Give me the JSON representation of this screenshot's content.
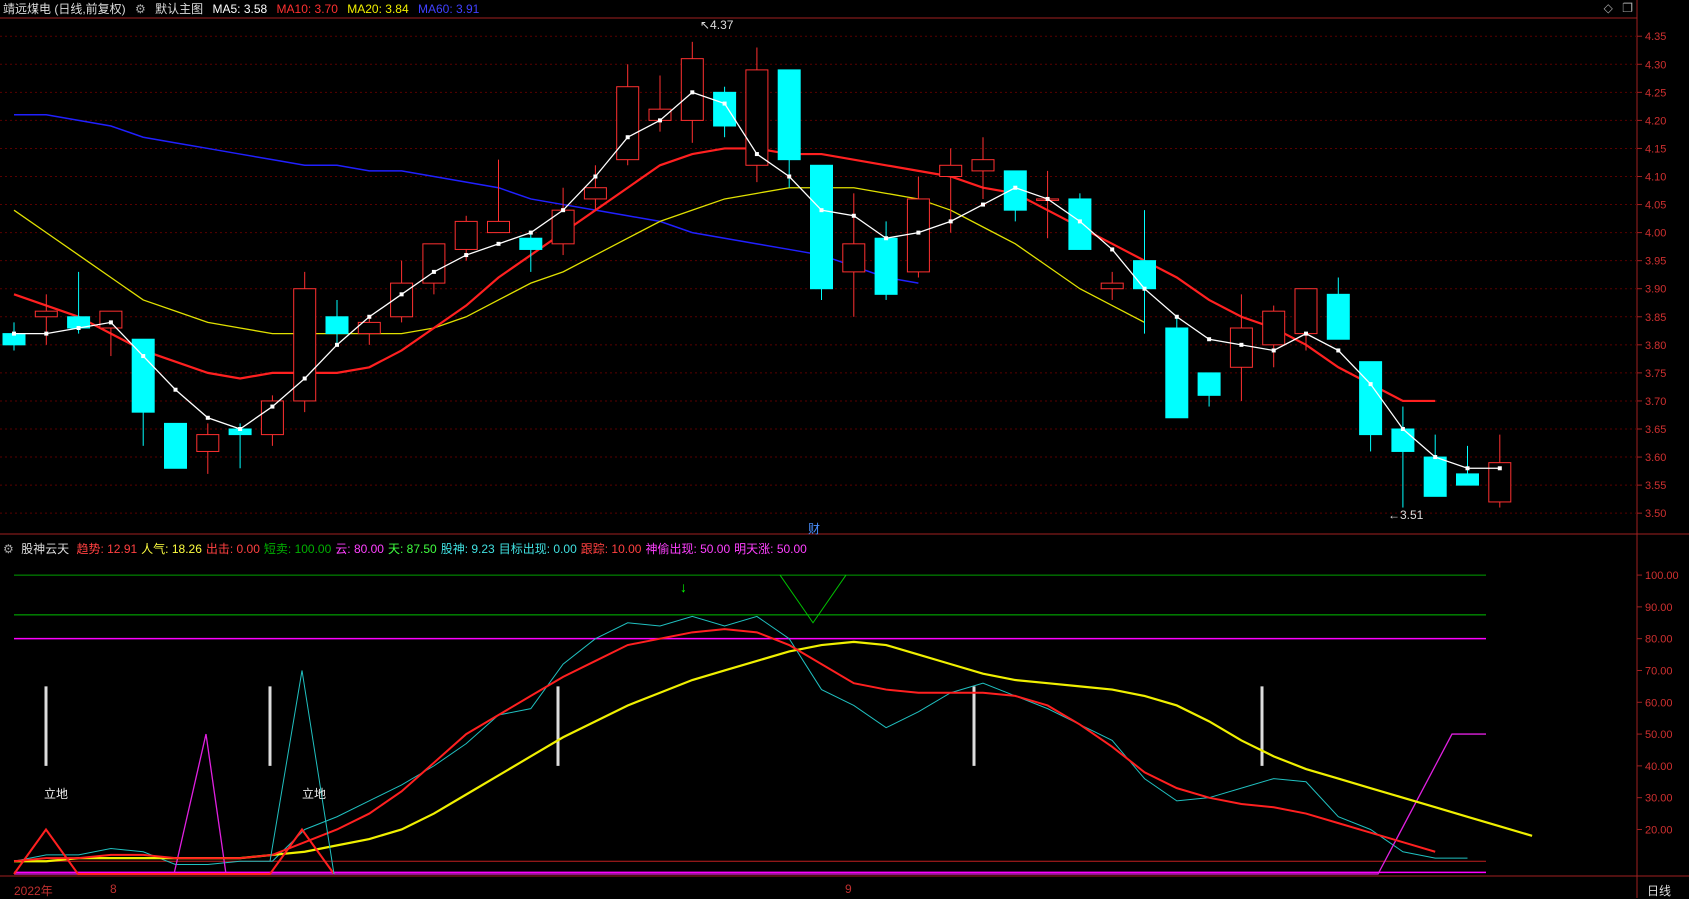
{
  "header": {
    "stock": "靖远煤电 (日线,前复权)",
    "main": "默认主图",
    "ma5_label": "MA5: 3.58",
    "ma10_label": "MA10: 3.70",
    "ma20_label": "MA20: 3.84",
    "ma60_label": "MA60: 3.91"
  },
  "indicator_header": {
    "name": "股神云天",
    "items": [
      {
        "text": "趋势: 12.91",
        "color": "#ff4040"
      },
      {
        "text": "人气: 18.26",
        "color": "#ffff40"
      },
      {
        "text": "出击: 0.00",
        "color": "#ff4040"
      },
      {
        "text": "短卖: 100.00",
        "color": "#00b000"
      },
      {
        "text": "云: 80.00",
        "color": "#ff40ff"
      },
      {
        "text": "天: 87.50",
        "color": "#40ff40"
      },
      {
        "text": "股神: 9.23",
        "color": "#40e0e0"
      },
      {
        "text": "目标出现: 0.00",
        "color": "#40e0e0"
      },
      {
        "text": "跟踪: 10.00",
        "color": "#ff4040"
      },
      {
        "text": "神偷出现: 50.00",
        "color": "#ff40ff"
      },
      {
        "text": "明天涨: 50.00",
        "color": "#ff40ff"
      }
    ]
  },
  "dates": {
    "year": "2022年",
    "m8": "8",
    "m9": "9"
  },
  "period": "日线",
  "cai": "财",
  "colors": {
    "up": "#ff3030",
    "down": "#00ffff",
    "ma5": "#ffffff",
    "ma10": "#ff2020",
    "ma20": "#e0e000",
    "ma60": "#2020ff"
  },
  "chart_data": [
    {
      "type": "candlestick",
      "ylim": [
        3.47,
        4.37
      ],
      "y_ticks": [
        3.5,
        3.55,
        3.6,
        3.65,
        3.7,
        3.75,
        3.8,
        3.85,
        3.9,
        3.95,
        4.0,
        4.05,
        4.1,
        4.15,
        4.2,
        4.25,
        4.3,
        4.35
      ],
      "candles": [
        [
          3.82,
          3.84,
          3.79,
          3.8
        ],
        [
          3.85,
          3.89,
          3.8,
          3.86
        ],
        [
          3.85,
          3.93,
          3.82,
          3.83
        ],
        [
          3.83,
          3.86,
          3.78,
          3.86
        ],
        [
          3.81,
          3.81,
          3.62,
          3.68
        ],
        [
          3.66,
          3.66,
          3.6,
          3.58
        ],
        [
          3.61,
          3.66,
          3.57,
          3.64
        ],
        [
          3.65,
          3.66,
          3.58,
          3.64
        ],
        [
          3.64,
          3.71,
          3.62,
          3.7
        ],
        [
          3.7,
          3.93,
          3.68,
          3.9
        ],
        [
          3.85,
          3.88,
          3.8,
          3.82
        ],
        [
          3.82,
          3.85,
          3.8,
          3.84
        ],
        [
          3.85,
          3.95,
          3.84,
          3.91
        ],
        [
          3.91,
          3.98,
          3.89,
          3.98
        ],
        [
          3.97,
          4.03,
          3.95,
          4.02
        ],
        [
          4.0,
          4.13,
          4.0,
          4.02
        ],
        [
          3.99,
          4.0,
          3.93,
          3.97
        ],
        [
          3.98,
          4.08,
          3.96,
          4.04
        ],
        [
          4.06,
          4.12,
          4.04,
          4.08
        ],
        [
          4.13,
          4.3,
          4.12,
          4.26
        ],
        [
          4.2,
          4.28,
          4.18,
          4.22
        ],
        [
          4.2,
          4.34,
          4.16,
          4.31
        ],
        [
          4.25,
          4.26,
          4.17,
          4.19
        ],
        [
          4.12,
          4.33,
          4.09,
          4.29
        ],
        [
          4.29,
          4.29,
          4.08,
          4.13
        ],
        [
          4.12,
          4.12,
          3.88,
          3.9
        ],
        [
          3.93,
          4.07,
          3.85,
          3.98
        ],
        [
          3.99,
          4.02,
          3.88,
          3.89
        ],
        [
          3.93,
          4.1,
          3.92,
          4.06
        ],
        [
          4.1,
          4.15,
          4.0,
          4.12
        ],
        [
          4.11,
          4.17,
          4.06,
          4.13
        ],
        [
          4.11,
          4.11,
          4.02,
          4.04
        ],
        [
          4.06,
          4.11,
          3.99,
          4.06
        ],
        [
          4.06,
          4.07,
          3.97,
          3.97
        ],
        [
          3.9,
          3.93,
          3.88,
          3.91
        ],
        [
          3.95,
          4.04,
          3.82,
          3.9
        ],
        [
          3.83,
          3.85,
          3.67,
          3.67
        ],
        [
          3.75,
          3.75,
          3.69,
          3.71
        ],
        [
          3.76,
          3.89,
          3.7,
          3.83
        ],
        [
          3.8,
          3.87,
          3.76,
          3.86
        ],
        [
          3.82,
          3.9,
          3.79,
          3.9
        ],
        [
          3.89,
          3.92,
          3.82,
          3.81
        ],
        [
          3.77,
          3.77,
          3.61,
          3.64
        ],
        [
          3.65,
          3.69,
          3.51,
          3.61
        ],
        [
          3.6,
          3.64,
          3.53,
          3.53
        ],
        [
          3.57,
          3.62,
          3.55,
          3.55
        ],
        [
          3.52,
          3.64,
          3.51,
          3.59
        ]
      ],
      "ma5": [
        3.82,
        3.82,
        3.83,
        3.84,
        3.78,
        3.72,
        3.67,
        3.65,
        3.69,
        3.74,
        3.8,
        3.85,
        3.89,
        3.93,
        3.96,
        3.98,
        4.0,
        4.04,
        4.1,
        4.17,
        4.2,
        4.25,
        4.23,
        4.14,
        4.1,
        4.04,
        4.03,
        3.99,
        4.0,
        4.02,
        4.05,
        4.08,
        4.06,
        4.02,
        3.97,
        3.9,
        3.85,
        3.81,
        3.8,
        3.79,
        3.82,
        3.79,
        3.73,
        3.65,
        3.6,
        3.58,
        3.58
      ],
      "ma10": [
        3.89,
        3.87,
        3.85,
        3.82,
        3.79,
        3.77,
        3.75,
        3.74,
        3.75,
        3.75,
        3.75,
        3.76,
        3.79,
        3.83,
        3.87,
        3.92,
        3.96,
        4.0,
        4.04,
        4.08,
        4.12,
        4.14,
        4.15,
        4.15,
        4.14,
        4.14,
        4.13,
        4.12,
        4.11,
        4.1,
        4.08,
        4.07,
        4.04,
        4.01,
        3.98,
        3.95,
        3.92,
        3.88,
        3.85,
        3.83,
        3.8,
        3.76,
        3.73,
        3.7,
        3.7
      ],
      "ma20": [
        4.04,
        4.0,
        3.96,
        3.92,
        3.88,
        3.86,
        3.84,
        3.83,
        3.82,
        3.82,
        3.82,
        3.82,
        3.82,
        3.83,
        3.85,
        3.88,
        3.91,
        3.93,
        3.96,
        3.99,
        4.02,
        4.04,
        4.06,
        4.07,
        4.08,
        4.08,
        4.08,
        4.07,
        4.06,
        4.04,
        4.01,
        3.98,
        3.94,
        3.9,
        3.87,
        3.84
      ],
      "ma60": [
        4.21,
        4.21,
        4.2,
        4.19,
        4.17,
        4.16,
        4.15,
        4.14,
        4.13,
        4.12,
        4.12,
        4.11,
        4.11,
        4.1,
        4.09,
        4.08,
        4.06,
        4.05,
        4.04,
        4.03,
        4.02,
        4.0,
        3.99,
        3.98,
        3.97,
        3.96,
        3.94,
        3.92,
        3.91
      ],
      "annotations": {
        "high": "4.37",
        "low": "3.51"
      }
    },
    {
      "type": "line",
      "name": "股神云天",
      "ylim": [
        6,
        106
      ],
      "y_ticks": [
        20,
        30,
        40,
        50,
        60,
        70,
        80,
        90,
        100
      ],
      "series": [
        {
          "key": "qushi",
          "values": [
            10,
            11,
            11,
            12,
            12,
            11,
            11,
            11,
            12,
            16,
            20,
            25,
            32,
            41,
            50,
            56,
            62,
            68,
            73,
            78,
            80,
            82,
            83,
            82,
            78,
            72,
            66,
            64,
            63,
            63,
            63,
            62,
            59,
            53,
            46,
            38,
            33,
            30,
            28,
            27,
            25,
            22,
            19,
            16,
            13
          ]
        },
        {
          "key": "renqi",
          "values": [
            10,
            10,
            11,
            11,
            11,
            11,
            11,
            11,
            12,
            13,
            15,
            17,
            20,
            25,
            31,
            37,
            43,
            49,
            54,
            59,
            63,
            67,
            70,
            73,
            76,
            78,
            79,
            78,
            75,
            72,
            69,
            67,
            66,
            65,
            64,
            62,
            59,
            54,
            48,
            43,
            39,
            36,
            33,
            30,
            27,
            24,
            21,
            18
          ]
        },
        {
          "key": "cyan",
          "values": [
            10,
            12,
            12,
            14,
            13,
            9,
            9,
            10,
            10,
            20,
            24,
            29,
            34,
            40,
            47,
            56,
            58,
            72,
            80,
            85,
            84,
            87,
            84,
            87,
            80,
            64,
            59,
            52,
            57,
            63,
            66,
            62,
            58,
            53,
            48,
            36,
            29,
            30,
            33,
            36,
            35,
            24,
            20,
            13,
            11,
            11
          ]
        },
        {
          "key": "magenta",
          "values": [
            6,
            6,
            6,
            6,
            6,
            6,
            50,
            6,
            6,
            6,
            6,
            6,
            6,
            6,
            6,
            6,
            6,
            6,
            6,
            6,
            6,
            6,
            6,
            6,
            6,
            6,
            6,
            6,
            6,
            6,
            6,
            6,
            6,
            6,
            6,
            6,
            6,
            6,
            6,
            6,
            6,
            6,
            6,
            6,
            50,
            50
          ]
        },
        {
          "key": "spikes",
          "values": [
            6,
            20,
            6,
            6,
            6,
            6,
            6,
            6,
            6,
            20,
            6
          ]
        },
        {
          "key": "cyan_spike",
          "values": [
            10,
            70,
            6
          ]
        }
      ],
      "labels": [
        "立地",
        "立地"
      ]
    }
  ]
}
